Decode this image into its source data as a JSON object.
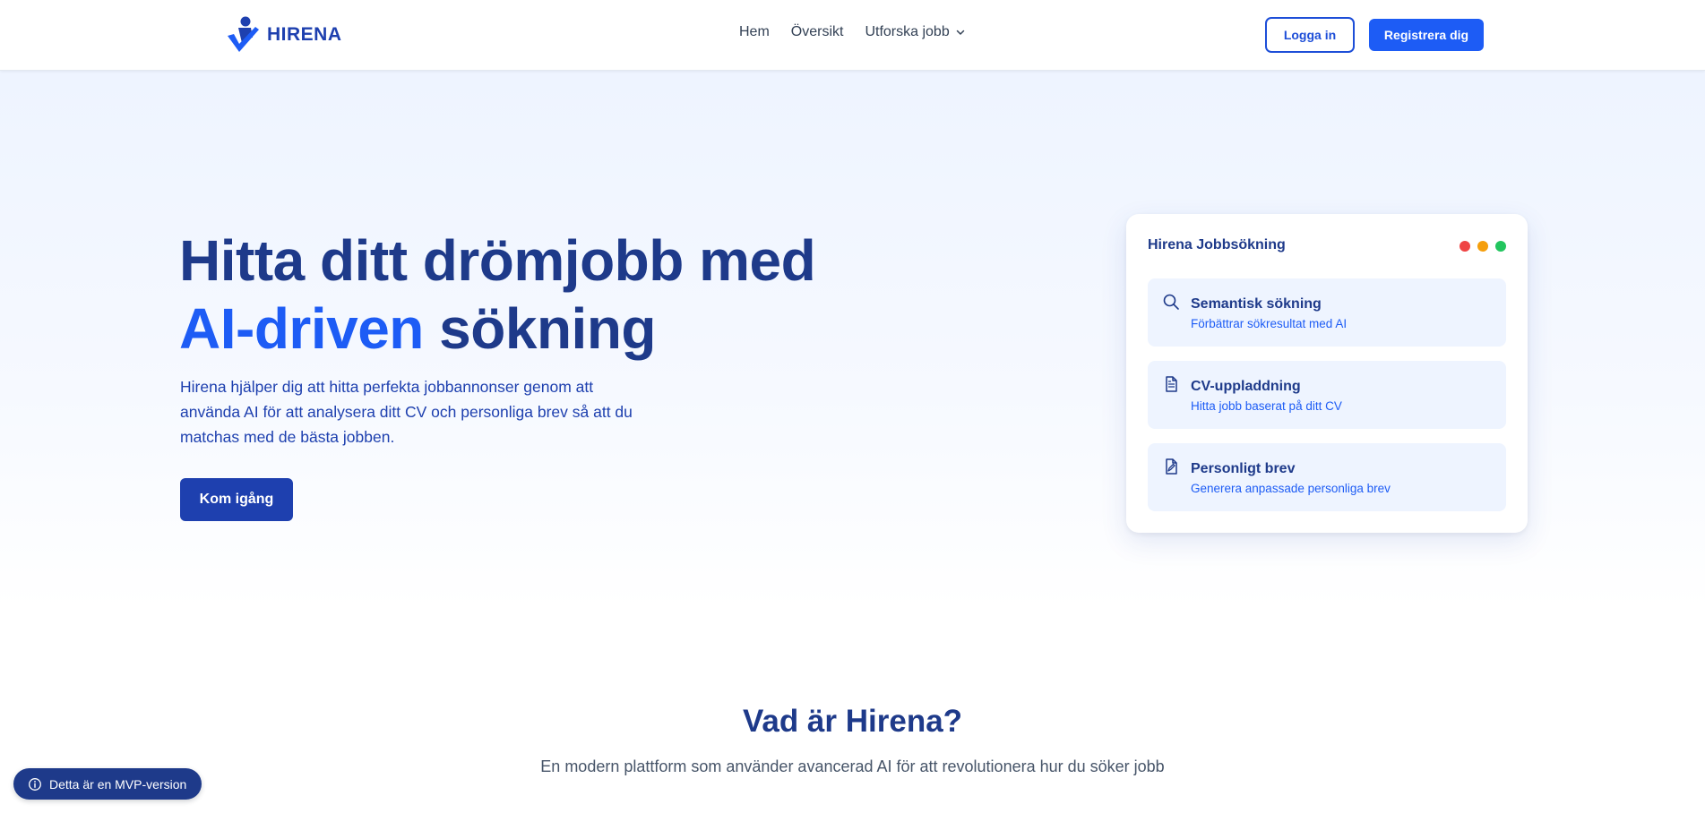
{
  "nav": {
    "brand": "HIRENA",
    "links": [
      {
        "label": "Hem"
      },
      {
        "label": "Översikt"
      },
      {
        "label": "Utforska jobb",
        "icon": "chevron-down-icon"
      }
    ],
    "login_label": "Logga in",
    "register_label": "Registrera dig"
  },
  "hero": {
    "title_line1": "Hitta ditt drömjobb med",
    "title_accent": "AI-driven",
    "title_rest": "sökning",
    "description": "Hirena hjälper dig att hitta perfekta jobbannonser genom att använda AI för att analysera ditt CV och personliga brev så att du matchas med de bästa jobben.",
    "cta_label": "Kom igång"
  },
  "card": {
    "title": "Hirena Jobbsökning",
    "dots": [
      "#ef4444",
      "#f59e0b",
      "#22c55e"
    ],
    "features": [
      {
        "icon": "search-icon",
        "title": "Semantisk sökning",
        "subtitle": "Förbättrar sökresultat med AI"
      },
      {
        "icon": "document-icon",
        "title": "CV-uppladdning",
        "subtitle": "Hitta jobb baserat på ditt CV"
      },
      {
        "icon": "file-signature-icon",
        "title": "Personligt brev",
        "subtitle": "Generera anpassade personliga brev"
      }
    ]
  },
  "section": {
    "title": "Vad är Hirena?",
    "subtitle": "En modern plattform som använder avancerad AI för att revolutionera hur du söker jobb"
  },
  "mvp_badge": {
    "icon": "info-icon",
    "label": "Detta är en MVP-version"
  },
  "colors": {
    "brand_dark": "#1e3a8a",
    "brand_primary": "#1d5cf5",
    "brand_button": "#1e40af"
  }
}
